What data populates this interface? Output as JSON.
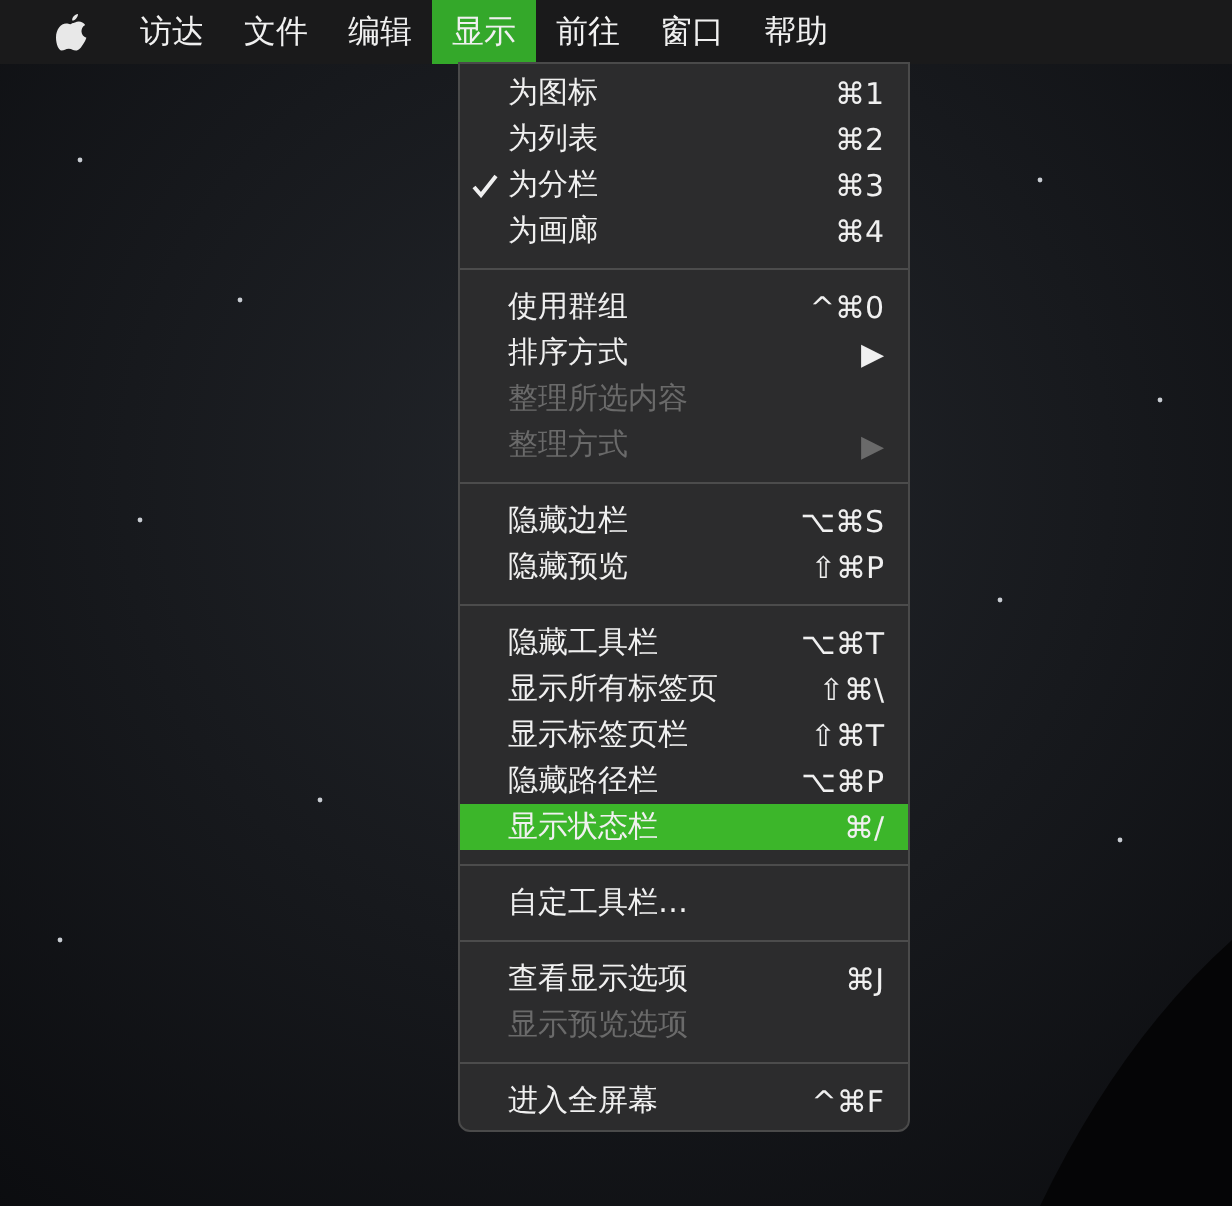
{
  "menubar": [
    {
      "label": "访达",
      "selected": false
    },
    {
      "label": "文件",
      "selected": false
    },
    {
      "label": "编辑",
      "selected": false
    },
    {
      "label": "显示",
      "selected": true
    },
    {
      "label": "前往",
      "selected": false
    },
    {
      "label": "窗口",
      "selected": false
    },
    {
      "label": "帮助",
      "selected": false
    }
  ],
  "menu": [
    {
      "kind": "item",
      "label": "为图标",
      "shortcut": "⌘1",
      "checked": false,
      "disabled": false,
      "selected": false
    },
    {
      "kind": "item",
      "label": "为列表",
      "shortcut": "⌘2",
      "checked": false,
      "disabled": false,
      "selected": false
    },
    {
      "kind": "item",
      "label": "为分栏",
      "shortcut": "⌘3",
      "checked": true,
      "disabled": false,
      "selected": false
    },
    {
      "kind": "item",
      "label": "为画廊",
      "shortcut": "⌘4",
      "checked": false,
      "disabled": false,
      "selected": false
    },
    {
      "kind": "separator"
    },
    {
      "kind": "item",
      "label": "使用群组",
      "shortcut": "^⌘0",
      "checked": false,
      "disabled": false,
      "selected": false
    },
    {
      "kind": "item",
      "label": "排序方式",
      "shortcut": "▶",
      "checked": false,
      "disabled": false,
      "selected": false
    },
    {
      "kind": "item",
      "label": "整理所选内容",
      "checked": false,
      "disabled": true,
      "selected": false
    },
    {
      "kind": "item",
      "label": "整理方式",
      "shortcut": "▶",
      "checked": false,
      "disabled": true,
      "selected": false
    },
    {
      "kind": "separator"
    },
    {
      "kind": "item",
      "label": "隐藏边栏",
      "shortcut": "⌥⌘S",
      "checked": false,
      "disabled": false,
      "selected": false
    },
    {
      "kind": "item",
      "label": "隐藏预览",
      "shortcut": "⇧⌘P",
      "checked": false,
      "disabled": false,
      "selected": false
    },
    {
      "kind": "separator"
    },
    {
      "kind": "item",
      "label": "隐藏工具栏",
      "shortcut": "⌥⌘T",
      "checked": false,
      "disabled": false,
      "selected": false
    },
    {
      "kind": "item",
      "label": "显示所有标签页",
      "shortcut": "⇧⌘\\",
      "checked": false,
      "disabled": false,
      "selected": false
    },
    {
      "kind": "item",
      "label": "显示标签页栏",
      "shortcut": "⇧⌘T",
      "checked": false,
      "disabled": false,
      "selected": false
    },
    {
      "kind": "item",
      "label": "隐藏路径栏",
      "shortcut": "⌥⌘P",
      "checked": false,
      "disabled": false,
      "selected": false
    },
    {
      "kind": "item",
      "label": "显示状态栏",
      "shortcut": "⌘/",
      "checked": false,
      "disabled": false,
      "selected": true
    },
    {
      "kind": "separator"
    },
    {
      "kind": "item",
      "label": "自定工具栏…",
      "checked": false,
      "disabled": false,
      "selected": false
    },
    {
      "kind": "separator"
    },
    {
      "kind": "item",
      "label": "查看显示选项",
      "shortcut": "⌘J",
      "checked": false,
      "disabled": false,
      "selected": false
    },
    {
      "kind": "item",
      "label": "显示预览选项",
      "checked": false,
      "disabled": true,
      "selected": false
    },
    {
      "kind": "separator"
    },
    {
      "kind": "item",
      "label": "进入全屏幕",
      "shortcut": "^⌘F",
      "checked": false,
      "disabled": false,
      "selected": false
    }
  ]
}
